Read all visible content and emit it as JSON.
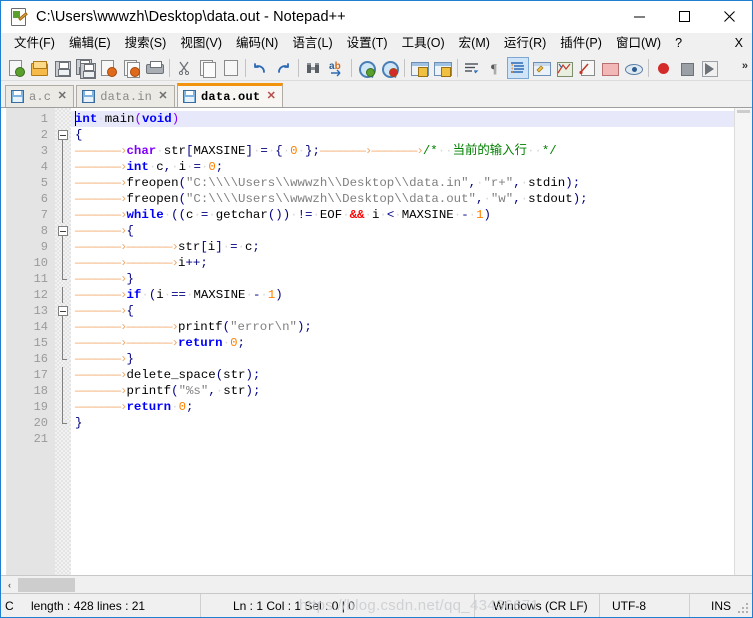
{
  "window": {
    "title": "C:\\Users\\wwwzh\\Desktop\\data.out - Notepad++",
    "icon": "notepad-plus-plus-icon",
    "buttons": {
      "minimize": "—",
      "maximize": "☐",
      "close": "✕"
    }
  },
  "menu": {
    "items": [
      {
        "label": "文件(F)",
        "name": "menu-file"
      },
      {
        "label": "编辑(E)",
        "name": "menu-edit"
      },
      {
        "label": "搜索(S)",
        "name": "menu-search"
      },
      {
        "label": "视图(V)",
        "name": "menu-view"
      },
      {
        "label": "编码(N)",
        "name": "menu-encoding"
      },
      {
        "label": "语言(L)",
        "name": "menu-language"
      },
      {
        "label": "设置(T)",
        "name": "menu-settings"
      },
      {
        "label": "工具(O)",
        "name": "menu-tools"
      },
      {
        "label": "宏(M)",
        "name": "menu-macro"
      },
      {
        "label": "运行(R)",
        "name": "menu-run"
      },
      {
        "label": "插件(P)",
        "name": "menu-plugins"
      },
      {
        "label": "窗口(W)",
        "name": "menu-window"
      },
      {
        "label": "?",
        "name": "menu-help"
      }
    ],
    "close_doc": "X"
  },
  "toolbar": {
    "overflow": "»",
    "buttons": [
      "new-file-icon",
      "open-file-icon",
      "save-icon",
      "save-all-icon",
      "close-file-icon",
      "close-all-icon",
      "print-icon",
      "sep",
      "cut-icon",
      "copy-icon",
      "paste-icon",
      "sep",
      "undo-icon",
      "redo-icon",
      "sep",
      "find-icon",
      "replace-icon",
      "sep",
      "zoom-in-icon",
      "zoom-out-icon",
      "sep",
      "sync-vertical-icon",
      "sync-horizontal-icon",
      "sep",
      "word-wrap-icon",
      "show-all-chars-icon",
      "indent-guide-icon",
      "user-define-dialog-icon",
      "document-map-icon",
      "function-list-icon",
      "folder-as-workspace-icon",
      "monitoring-icon",
      "sep",
      "record-macro-icon",
      "stop-record-icon",
      "play-macro-icon"
    ]
  },
  "tabs": [
    {
      "label": "a.c",
      "active": false,
      "name": "tab-a-c"
    },
    {
      "label": "data.in",
      "active": false,
      "name": "tab-data-in"
    },
    {
      "label": "data.out",
      "active": true,
      "name": "tab-data-out"
    }
  ],
  "editor": {
    "line_count": 21,
    "line_numbers": [
      1,
      2,
      3,
      4,
      5,
      6,
      7,
      8,
      9,
      10,
      11,
      12,
      13,
      14,
      15,
      16,
      17,
      18,
      19,
      20,
      21
    ],
    "current_line": 1,
    "fold_open_lines": [
      2,
      8,
      13
    ],
    "fold_end_lines": [
      11,
      16,
      20
    ],
    "fold_bar_lines": [
      3,
      4,
      5,
      6,
      7,
      9,
      10,
      12,
      14,
      15,
      17,
      18,
      19
    ],
    "lines": [
      {
        "n": 1,
        "tokens": [
          {
            "t": "int",
            "c": "kw"
          },
          {
            "t": "·",
            "c": "dot"
          },
          {
            "t": "main",
            "c": "id"
          },
          {
            "t": "(",
            "c": "par"
          },
          {
            "t": "void",
            "c": "kw"
          },
          {
            "t": ")",
            "c": "par"
          }
        ]
      },
      {
        "n": 2,
        "tokens": [
          {
            "t": "{",
            "c": "op"
          }
        ]
      },
      {
        "n": 3,
        "tokens": [
          {
            "t": "———————›",
            "c": "tabarrow"
          },
          {
            "t": "char",
            "c": "kw2"
          },
          {
            "t": "·",
            "c": "dot"
          },
          {
            "t": "str",
            "c": "id"
          },
          {
            "t": "[",
            "c": "op"
          },
          {
            "t": "MAXSINE",
            "c": "id"
          },
          {
            "t": "]",
            "c": "op"
          },
          {
            "t": "·",
            "c": "dot"
          },
          {
            "t": "=",
            "c": "op"
          },
          {
            "t": "·",
            "c": "dot"
          },
          {
            "t": "{",
            "c": "op"
          },
          {
            "t": "·",
            "c": "dot"
          },
          {
            "t": "0",
            "c": "num"
          },
          {
            "t": "·",
            "c": "dot"
          },
          {
            "t": "}",
            "c": "op"
          },
          {
            "t": ";",
            "c": "op"
          },
          {
            "t": "———————›",
            "c": "tabarrow"
          },
          {
            "t": "———————›",
            "c": "tabarrow"
          },
          {
            "t": "/*",
            "c": "cmt"
          },
          {
            "t": "··",
            "c": "dot"
          },
          {
            "t": "当前的输入行",
            "c": "cmt"
          },
          {
            "t": "··",
            "c": "dot"
          },
          {
            "t": "*/",
            "c": "cmt"
          }
        ]
      },
      {
        "n": 4,
        "tokens": [
          {
            "t": "———————›",
            "c": "tabarrow"
          },
          {
            "t": "int",
            "c": "kw"
          },
          {
            "t": "·",
            "c": "dot"
          },
          {
            "t": "c",
            "c": "id"
          },
          {
            "t": ",",
            "c": "op"
          },
          {
            "t": "·",
            "c": "dot"
          },
          {
            "t": "i",
            "c": "id"
          },
          {
            "t": "·",
            "c": "dot"
          },
          {
            "t": "=",
            "c": "op"
          },
          {
            "t": "·",
            "c": "dot"
          },
          {
            "t": "0",
            "c": "num"
          },
          {
            "t": ";",
            "c": "op"
          }
        ]
      },
      {
        "n": 5,
        "tokens": [
          {
            "t": "———————›",
            "c": "tabarrow"
          },
          {
            "t": "freopen",
            "c": "id"
          },
          {
            "t": "(",
            "c": "op"
          },
          {
            "t": "\"C:\\\\\\\\Users\\\\wwwzh\\\\Desktop\\\\data.in\"",
            "c": "str"
          },
          {
            "t": ",",
            "c": "op"
          },
          {
            "t": "·",
            "c": "dot"
          },
          {
            "t": "\"r+\"",
            "c": "str"
          },
          {
            "t": ",",
            "c": "op"
          },
          {
            "t": "·",
            "c": "dot"
          },
          {
            "t": "stdin",
            "c": "id"
          },
          {
            "t": ")",
            "c": "op"
          },
          {
            "t": ";",
            "c": "op"
          }
        ]
      },
      {
        "n": 6,
        "tokens": [
          {
            "t": "———————›",
            "c": "tabarrow"
          },
          {
            "t": "freopen",
            "c": "id"
          },
          {
            "t": "(",
            "c": "op"
          },
          {
            "t": "\"C:\\\\\\\\Users\\\\wwwzh\\\\Desktop\\\\data.out\"",
            "c": "str"
          },
          {
            "t": ",",
            "c": "op"
          },
          {
            "t": "·",
            "c": "dot"
          },
          {
            "t": "\"w\"",
            "c": "str"
          },
          {
            "t": ",",
            "c": "op"
          },
          {
            "t": "·",
            "c": "dot"
          },
          {
            "t": "stdout",
            "c": "id"
          },
          {
            "t": ")",
            "c": "op"
          },
          {
            "t": ";",
            "c": "op"
          }
        ]
      },
      {
        "n": 7,
        "tokens": [
          {
            "t": "———————›",
            "c": "tabarrow"
          },
          {
            "t": "while",
            "c": "kw"
          },
          {
            "t": "·",
            "c": "dot"
          },
          {
            "t": "(",
            "c": "op"
          },
          {
            "t": "(",
            "c": "op"
          },
          {
            "t": "c",
            "c": "id"
          },
          {
            "t": "·",
            "c": "dot"
          },
          {
            "t": "=",
            "c": "op"
          },
          {
            "t": "·",
            "c": "dot"
          },
          {
            "t": "getchar",
            "c": "id"
          },
          {
            "t": "()",
            "c": "op"
          },
          {
            "t": ")",
            "c": "op"
          },
          {
            "t": "·",
            "c": "dot"
          },
          {
            "t": "!=",
            "c": "op"
          },
          {
            "t": "·",
            "c": "dot"
          },
          {
            "t": "EOF",
            "c": "id"
          },
          {
            "t": "·",
            "c": "dot"
          },
          {
            "t": "&&",
            "c": "opr"
          },
          {
            "t": "·",
            "c": "dot"
          },
          {
            "t": "i",
            "c": "id"
          },
          {
            "t": "·",
            "c": "dot"
          },
          {
            "t": "<",
            "c": "op"
          },
          {
            "t": "·",
            "c": "dot"
          },
          {
            "t": "MAXSINE",
            "c": "id"
          },
          {
            "t": "·",
            "c": "dot"
          },
          {
            "t": "-",
            "c": "op"
          },
          {
            "t": "·",
            "c": "dot"
          },
          {
            "t": "1",
            "c": "num"
          },
          {
            "t": ")",
            "c": "op"
          }
        ]
      },
      {
        "n": 8,
        "tokens": [
          {
            "t": "———————›",
            "c": "tabarrow"
          },
          {
            "t": "{",
            "c": "op"
          }
        ]
      },
      {
        "n": 9,
        "tokens": [
          {
            "t": "———————›",
            "c": "tabarrow"
          },
          {
            "t": "———————›",
            "c": "tabarrow"
          },
          {
            "t": "str",
            "c": "id"
          },
          {
            "t": "[",
            "c": "op"
          },
          {
            "t": "i",
            "c": "id"
          },
          {
            "t": "]",
            "c": "op"
          },
          {
            "t": "·",
            "c": "dot"
          },
          {
            "t": "=",
            "c": "op"
          },
          {
            "t": "·",
            "c": "dot"
          },
          {
            "t": "c",
            "c": "id"
          },
          {
            "t": ";",
            "c": "op"
          }
        ]
      },
      {
        "n": 10,
        "tokens": [
          {
            "t": "———————›",
            "c": "tabarrow"
          },
          {
            "t": "———————›",
            "c": "tabarrow"
          },
          {
            "t": "i",
            "c": "id"
          },
          {
            "t": "++",
            "c": "op"
          },
          {
            "t": ";",
            "c": "op"
          }
        ]
      },
      {
        "n": 11,
        "tokens": [
          {
            "t": "———————›",
            "c": "tabarrow"
          },
          {
            "t": "}",
            "c": "op"
          }
        ]
      },
      {
        "n": 12,
        "tokens": [
          {
            "t": "———————›",
            "c": "tabarrow"
          },
          {
            "t": "if",
            "c": "kw"
          },
          {
            "t": "·",
            "c": "dot"
          },
          {
            "t": "(",
            "c": "op"
          },
          {
            "t": "i",
            "c": "id"
          },
          {
            "t": "·",
            "c": "dot"
          },
          {
            "t": "==",
            "c": "op"
          },
          {
            "t": "·",
            "c": "dot"
          },
          {
            "t": "MAXSINE",
            "c": "id"
          },
          {
            "t": "·",
            "c": "dot"
          },
          {
            "t": "-",
            "c": "op"
          },
          {
            "t": "·",
            "c": "dot"
          },
          {
            "t": "1",
            "c": "num"
          },
          {
            "t": ")",
            "c": "op"
          }
        ]
      },
      {
        "n": 13,
        "tokens": [
          {
            "t": "———————›",
            "c": "tabarrow"
          },
          {
            "t": "{",
            "c": "op"
          }
        ]
      },
      {
        "n": 14,
        "tokens": [
          {
            "t": "———————›",
            "c": "tabarrow"
          },
          {
            "t": "———————›",
            "c": "tabarrow"
          },
          {
            "t": "printf",
            "c": "id"
          },
          {
            "t": "(",
            "c": "op"
          },
          {
            "t": "\"error\\n\"",
            "c": "str"
          },
          {
            "t": ")",
            "c": "op"
          },
          {
            "t": ";",
            "c": "op"
          }
        ]
      },
      {
        "n": 15,
        "tokens": [
          {
            "t": "———————›",
            "c": "tabarrow"
          },
          {
            "t": "———————›",
            "c": "tabarrow"
          },
          {
            "t": "return",
            "c": "kw"
          },
          {
            "t": "·",
            "c": "dot"
          },
          {
            "t": "0",
            "c": "num"
          },
          {
            "t": ";",
            "c": "op"
          }
        ]
      },
      {
        "n": 16,
        "tokens": [
          {
            "t": "———————›",
            "c": "tabarrow"
          },
          {
            "t": "}",
            "c": "op"
          }
        ]
      },
      {
        "n": 17,
        "tokens": [
          {
            "t": "———————›",
            "c": "tabarrow"
          },
          {
            "t": "delete_space",
            "c": "id"
          },
          {
            "t": "(",
            "c": "op"
          },
          {
            "t": "str",
            "c": "id"
          },
          {
            "t": ")",
            "c": "op"
          },
          {
            "t": ";",
            "c": "op"
          }
        ]
      },
      {
        "n": 18,
        "tokens": [
          {
            "t": "———————›",
            "c": "tabarrow"
          },
          {
            "t": "printf",
            "c": "id"
          },
          {
            "t": "(",
            "c": "op"
          },
          {
            "t": "\"%s\"",
            "c": "str"
          },
          {
            "t": ",",
            "c": "op"
          },
          {
            "t": "·",
            "c": "dot"
          },
          {
            "t": "str",
            "c": "id"
          },
          {
            "t": ")",
            "c": "op"
          },
          {
            "t": ";",
            "c": "op"
          }
        ]
      },
      {
        "n": 19,
        "tokens": [
          {
            "t": "———————›",
            "c": "tabarrow"
          },
          {
            "t": "return",
            "c": "kw"
          },
          {
            "t": "·",
            "c": "dot"
          },
          {
            "t": "0",
            "c": "num"
          },
          {
            "t": ";",
            "c": "op"
          }
        ]
      },
      {
        "n": 20,
        "tokens": [
          {
            "t": "}",
            "c": "op"
          }
        ]
      },
      {
        "n": 21,
        "tokens": []
      }
    ]
  },
  "scrollbars": {
    "h_left_arrow": "‹"
  },
  "statusbar": {
    "language": "C",
    "length_lines": "length : 428    lines : 21",
    "position": "Ln : 1    Col : 1    Sel : 0 | 0",
    "eol": "Windows (CR LF)",
    "encoding": "UTF-8",
    "insert_mode": "INS"
  },
  "watermark": "https://blog.csdn.net/qq_43436671",
  "colors": {
    "accent_blue": "#1f7fd0",
    "active_tab_top": "#f2930d",
    "keyword": "#0000ff",
    "type_keyword": "#8000ff",
    "number": "#ff8000",
    "string": "#808080",
    "comment": "#008000",
    "operator": "#000080",
    "current_line_bg": "#e8e8fb",
    "gutter_bg": "#e4e4e4"
  }
}
